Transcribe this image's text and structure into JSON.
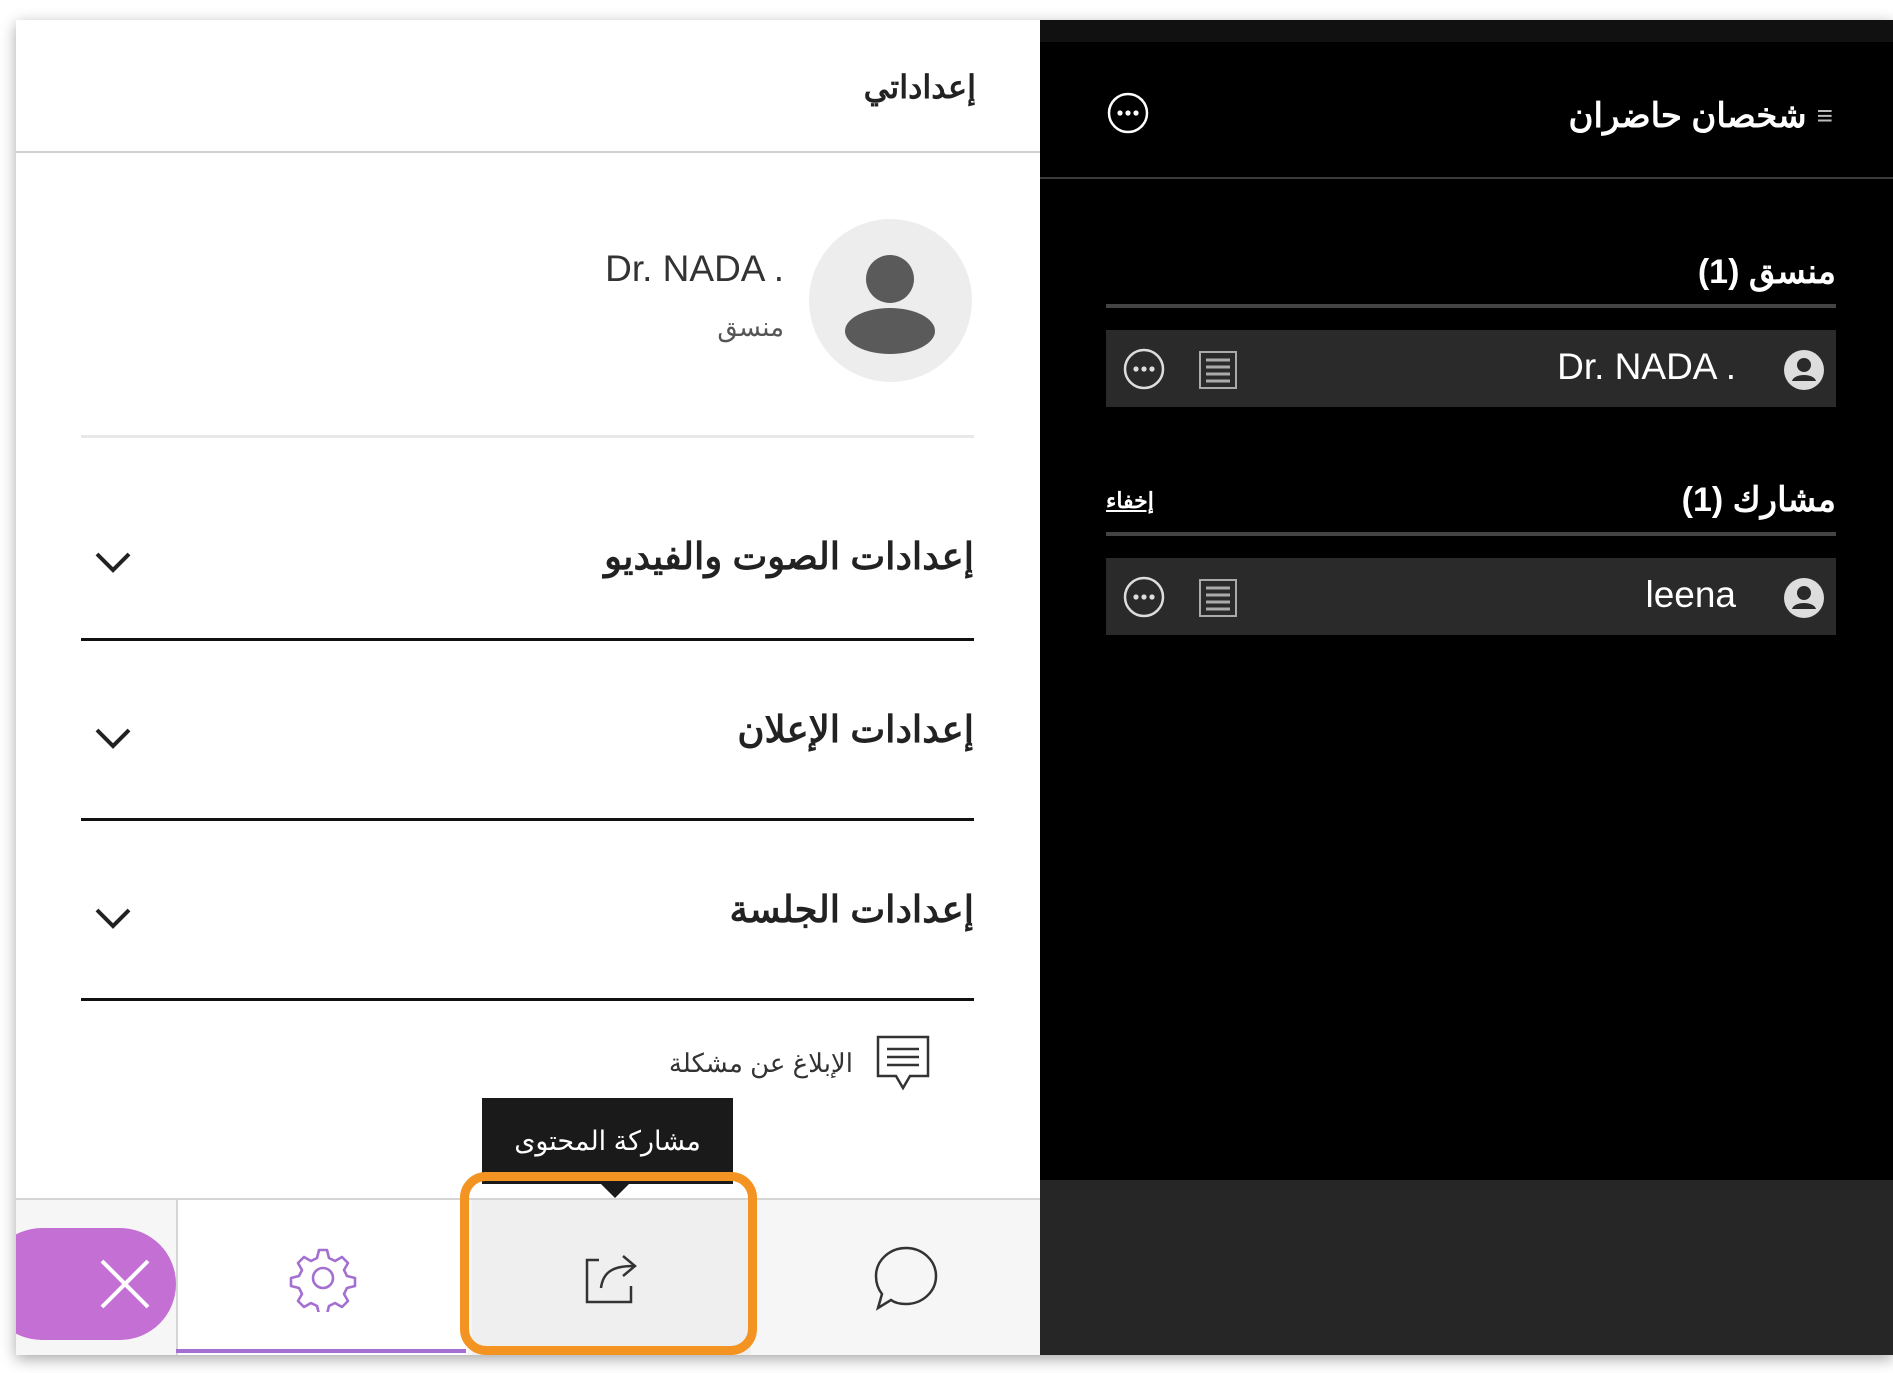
{
  "settings_panel": {
    "title": "إعداداتي",
    "user": {
      "name": "Dr. NADA .",
      "role": "منسق"
    },
    "sections": [
      {
        "label": "إعدادات الصوت والفيديو"
      },
      {
        "label": "إعدادات الإعلان"
      },
      {
        "label": "إعدادات الجلسة"
      }
    ],
    "report_issue": "الإبلاغ عن مشكلة"
  },
  "tooltip": {
    "text": "مشاركة المحتوى"
  },
  "bottom_nav": {
    "tabs": [
      {
        "icon": "gear-icon",
        "active": true
      },
      {
        "icon": "share-icon",
        "highlighted": true
      },
      {
        "icon": "chat-icon"
      }
    ],
    "close_icon": "close-icon"
  },
  "attendees_panel": {
    "title": "شخصان حاضران",
    "groups": [
      {
        "label": "منسق (1)",
        "people": [
          {
            "name": "Dr. NADA ."
          }
        ]
      },
      {
        "label": "مشارك (1)",
        "hide_label": "إخفاء",
        "people": [
          {
            "name": "leena"
          }
        ]
      }
    ]
  },
  "colors": {
    "accent": "#a46fd0",
    "close_button": "#c36fd4",
    "highlight": "#f39321"
  }
}
